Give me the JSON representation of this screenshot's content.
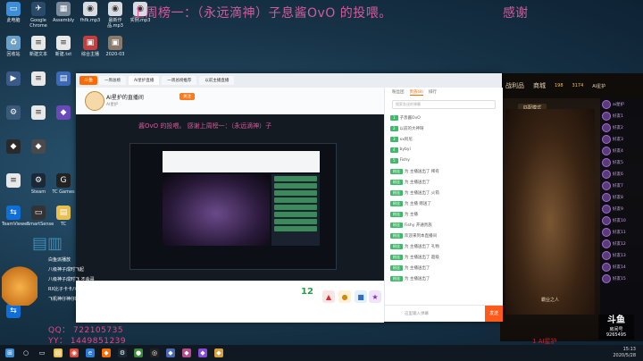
{
  "marquee": {
    "text": "上周榜一：（永远滴神）子息酱OvO 的投喂。",
    "thanks": "感谢"
  },
  "desktop_icons": [
    {
      "label": "此电脑",
      "icon": "computer-icon",
      "color": "#3b8ed8"
    },
    {
      "label": "Google Chrome",
      "icon": "plane-icon",
      "color": "#2a4a6a"
    },
    {
      "label": "Assembly",
      "icon": "assembly-icon",
      "color": "#7a8a9a"
    },
    {
      "label": "fhfk.mp3",
      "icon": "audio-file-icon",
      "color": "#d8dce0"
    },
    {
      "label": "最新作品.mp3",
      "icon": "audio-file-icon",
      "color": "#d8dce0"
    },
    {
      "label": "实例.mp3",
      "icon": "audio-file-icon",
      "color": "#d8dce0"
    },
    {
      "label": "回收站",
      "icon": "recycle-bin-icon",
      "color": "#6aa0c8"
    },
    {
      "label": "新建文本",
      "icon": "text-file-icon",
      "color": "#e8e8e8"
    },
    {
      "label": "新建.txt",
      "icon": "text-file-icon",
      "color": "#e8e8e8"
    },
    {
      "label": "综合主播",
      "icon": "image-file-icon",
      "color": "#c04040"
    },
    {
      "label": "2020-03",
      "icon": "image-file-icon",
      "color": "#8a7a6a"
    },
    {
      "label": "Steam",
      "icon": "steam-icon",
      "color": "#1b2838"
    },
    {
      "label": "TC Games",
      "icon": "tc-games-icon",
      "color": "#222"
    },
    {
      "label": "TeamViewer",
      "icon": "teamviewer-icon",
      "color": "#0e6fd8"
    },
    {
      "label": "SmartSense",
      "icon": "smartsense-icon",
      "color": "#333"
    },
    {
      "label": "TC",
      "icon": "folder-icon",
      "color": "#e8c050"
    }
  ],
  "window": {
    "tabs": [
      "一周总榜",
      "AI星护直播",
      "一周总榜推荐",
      "以前主播直播",
      "以前主播直播"
    ],
    "logo": "斗鱼",
    "anchor_name": "AI星护的直播间",
    "anchor_sub": "AI星护",
    "follow_label": "关注",
    "inner_marquee": "酱OvO 的投喂。      感谢上周榜一：（永远滴神）子",
    "level_num": "12",
    "chat": {
      "tabs": [
        "粉丝团",
        "贵族(8)",
        "排行"
      ],
      "search_placeholder": "搜索发送的弹幕",
      "messages": [
        {
          "badge": "1",
          "text": "子息酱OvO"
        },
        {
          "badge": "2",
          "text": "以前的大神呀"
        },
        {
          "badge": "3",
          "text": "xx阿尼"
        },
        {
          "badge": "4",
          "text": "bybyi"
        },
        {
          "badge": "5",
          "text": "Fishy"
        },
        {
          "badge": "粉丝",
          "text": "为 主播送出了 稀有"
        },
        {
          "badge": "粉丝",
          "text": "为 主播送出了"
        },
        {
          "badge": "粉丝",
          "text": "为 主播送出了 火箭"
        },
        {
          "badge": "粉丝",
          "text": "为 主播 赠送了"
        },
        {
          "badge": "粉丝",
          "text": "为 主播"
        },
        {
          "badge": "粉丝",
          "text": "Fishy 开通贵族"
        },
        {
          "badge": "粉丝",
          "text": "欢迎来到本直播间"
        },
        {
          "badge": "粉丝",
          "text": "为 主播送出了 礼物"
        },
        {
          "badge": "粉丝",
          "text": "为 主播送出了 超级"
        },
        {
          "badge": "粉丝",
          "text": "为 主播送出了"
        },
        {
          "badge": "粉丝",
          "text": "为 主播送出了"
        }
      ],
      "input_placeholder": "这里输入弹幕",
      "send_label": "发送"
    }
  },
  "game": {
    "tabs": [
      "战利品",
      "商城"
    ],
    "mode_label": "匹配模式",
    "stat1": "198",
    "stat2": "3174",
    "player_name": "AI星护",
    "bottom_label": "霸业之人",
    "roster": [
      "ai星护",
      "好友1",
      "好友2",
      "好友3",
      "好友4",
      "好友5",
      "好友6",
      "好友7",
      "好友8",
      "好友9",
      "好友10",
      "好友11",
      "好友12",
      "好友13",
      "好友14",
      "好友15"
    ]
  },
  "overlay": {
    "qq": "QQ：  722105735",
    "yy": "YY：  1449851239",
    "lines": [
      "白鱼派播放",
      "八级神子成时飞起",
      "八级神子成时飞 不会哥",
      "RX比子卡卡八级开播",
      "飞机神仔神仔精简"
    ]
  },
  "douyu": {
    "logo": "斗鱼",
    "sub": "房间号",
    "room": "9265495"
  },
  "taskbar": {
    "time": "15:13",
    "date": "2020/5/28"
  },
  "red_line": "1    AI星护"
}
